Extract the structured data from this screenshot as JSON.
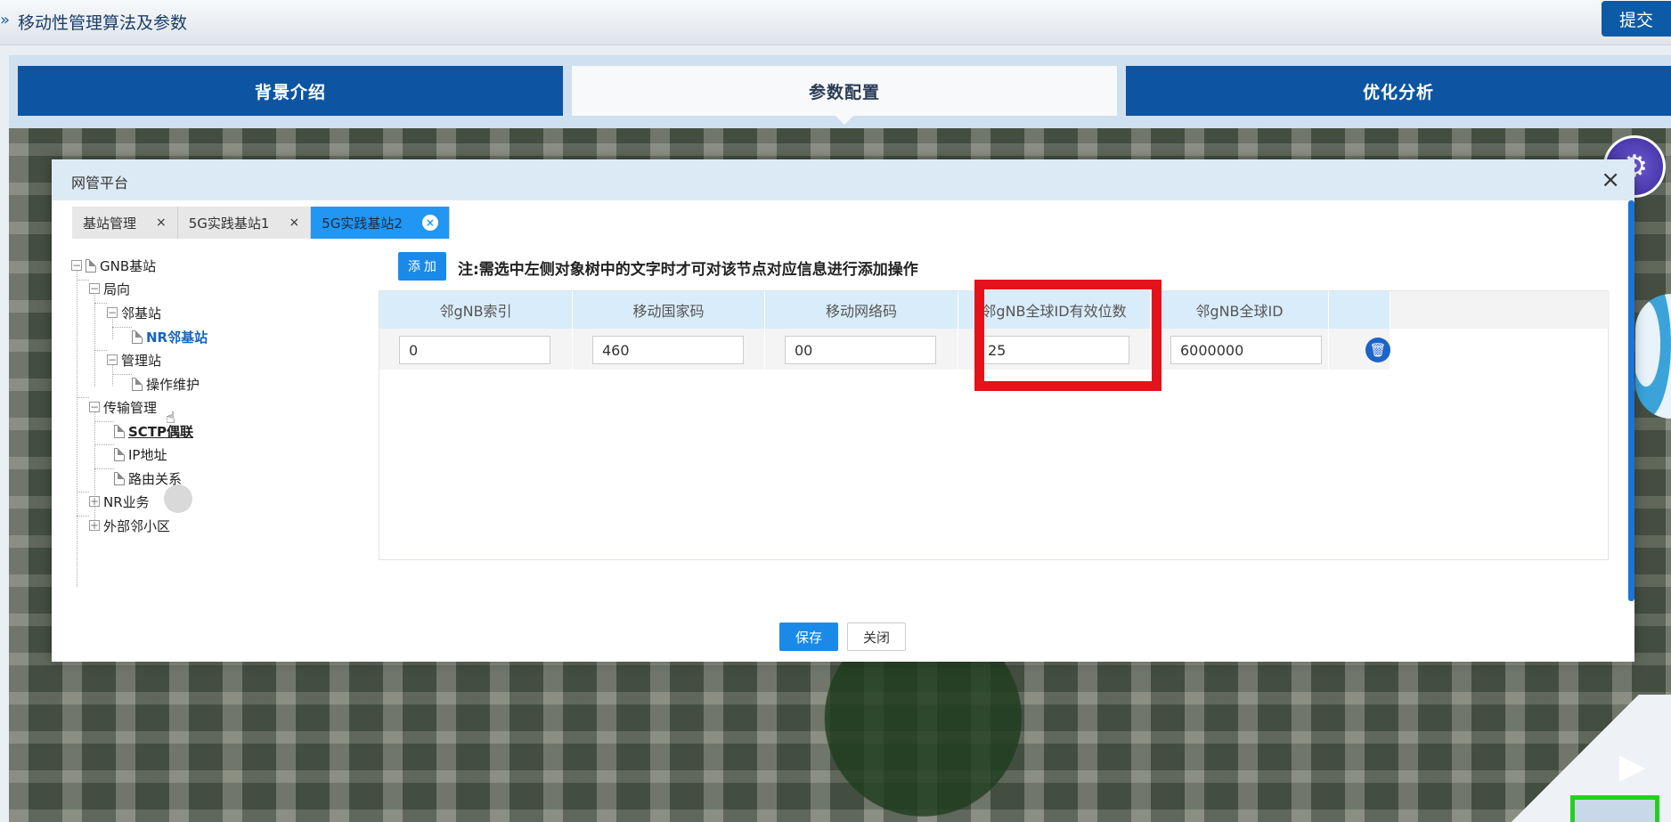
{
  "header": {
    "chevron": "»",
    "title": "移动性管理算法及参数",
    "submit_label": "提交"
  },
  "nav_tabs": [
    {
      "label": "背景介绍",
      "active": false
    },
    {
      "label": "参数配置",
      "active": true
    },
    {
      "label": "优化分析",
      "active": false
    }
  ],
  "modal": {
    "title": "网管平台",
    "close_glyph": "×",
    "tabs": [
      {
        "label": "基站管理",
        "active": false
      },
      {
        "label": "5G实践基站1",
        "active": false
      },
      {
        "label": "5G实践基站2",
        "active": true
      }
    ],
    "tab_close_glyph": "×",
    "tree": {
      "root": "GNB基站",
      "jx": "局向",
      "ljz": "邻基站",
      "nrljz": "NR邻基站",
      "glz": "管理站",
      "czwh": "操作维护",
      "csgl": "传输管理",
      "sctp": "SCTP偶联",
      "ip": "IP地址",
      "lygx": "路由关系",
      "nrywu": "NR业务",
      "wbxq": "外部邻小区"
    },
    "add_label": "添 加",
    "note": "注:需选中左侧对象树中的文字时才可对该节点对应信息进行添加操作",
    "table": {
      "headers": [
        "邻gNB索引",
        "移动国家码",
        "移动网络码",
        "邻gNB全球ID有效位数",
        "邻gNB全球ID"
      ],
      "row": [
        "0",
        "460",
        "00",
        "25",
        "6000000"
      ]
    },
    "save_label": "保存",
    "close_label": "关闭"
  },
  "colors": {
    "nav_blue": "#0d55a3",
    "button_blue": "#1b89e8",
    "highlight_red": "#e3121b",
    "highlight_green": "#22d11d"
  },
  "icons": [
    "chevron-right-icon",
    "close-icon",
    "document-icon",
    "expand-icon",
    "collapse-icon",
    "delete-icon",
    "gear-icon",
    "video-icon",
    "mouse-pointer-icon"
  ]
}
